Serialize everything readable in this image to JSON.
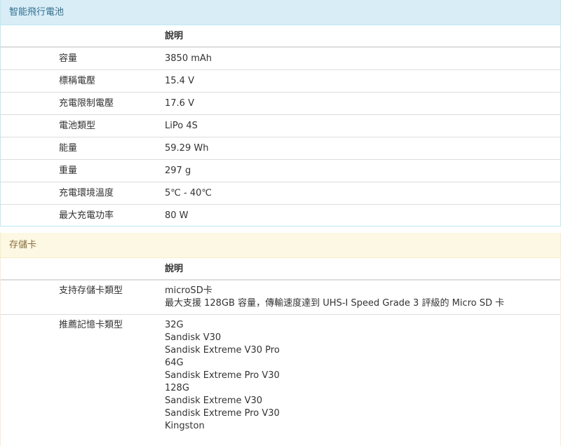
{
  "battery": {
    "title": "智能飛行電池",
    "header": "說明",
    "rows": [
      {
        "label": "容量",
        "value": "3850 mAh"
      },
      {
        "label": "標稱電壓",
        "value": "15.4 V"
      },
      {
        "label": "充電限制電壓",
        "value": "17.6 V"
      },
      {
        "label": "電池類型",
        "value": "LiPo 4S"
      },
      {
        "label": "能量",
        "value": "59.29 Wh"
      },
      {
        "label": "重量",
        "value": "297 g"
      },
      {
        "label": "充電環境溫度",
        "value": "5℃ - 40℃"
      },
      {
        "label": "最大充電功率",
        "value": "80 W"
      }
    ]
  },
  "storage": {
    "title": "存儲卡",
    "header": "說明",
    "supported": {
      "label": "支持存儲卡類型",
      "lines": [
        "microSD卡",
        "最大支援 128GB 容量，傳輸速度達到 UHS-I Speed Grade 3 評級的 Micro SD 卡"
      ]
    },
    "recommended": {
      "label": "推薦記憶卡類型",
      "lines": [
        "32G",
        "Sandisk V30",
        "Sandisk Extreme V30 Pro",
        "64G",
        "Sandisk Extreme Pro V30",
        "128G",
        "Sandisk Extreme V30",
        "Sandisk Extreme Pro V30",
        "Kingston"
      ]
    }
  }
}
